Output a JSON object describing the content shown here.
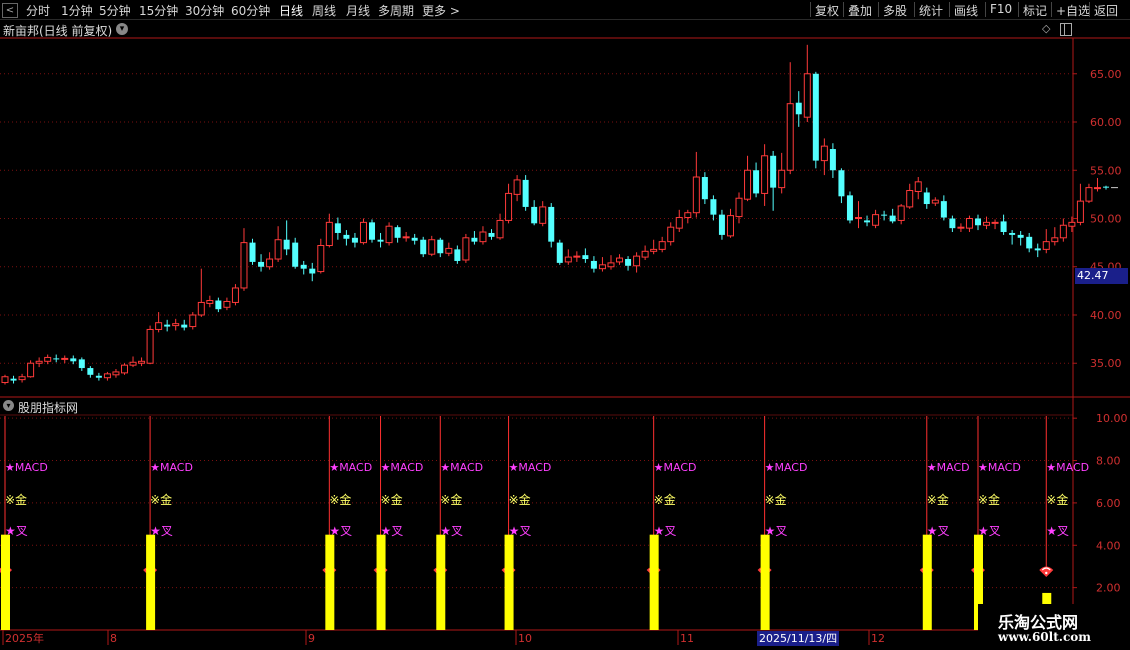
{
  "toolbar": {
    "back_arrow": "<",
    "period_tabs": [
      "分时",
      "1分钟",
      "5分钟",
      "15分钟",
      "30分钟",
      "60分钟",
      "日线",
      "周线",
      "月线",
      "多周期",
      "更多 >"
    ],
    "active_tab": "日线",
    "right_buttons": [
      "复权",
      "叠加",
      "多股",
      "统计",
      "画线",
      "F10",
      "标记",
      "+自选",
      "返回"
    ]
  },
  "stock": {
    "title": "新亩邦(日线 前复权)",
    "current_price": "42.47"
  },
  "indicator": {
    "title": "股朋指标网",
    "signal_labels": {
      "macd": "★MACD",
      "gold": "※金",
      "cross": "★叉"
    }
  },
  "watermark": {
    "title": "乐淘公式网",
    "url": "www.60lt.com"
  },
  "crosshair_date": "2025/11/13/四",
  "colors": {
    "up": "#ff3a3a",
    "down": "#54ffff",
    "grid": "#7a1010",
    "axis": "#b01818",
    "signal_bar": "#ffff00",
    "macd_text": "#ff40ff",
    "gold_text": "#ffff66"
  },
  "chart_data": {
    "type": "candlestick",
    "price_axis": {
      "ticks": [
        "65.00",
        "60.00",
        "55.00",
        "50.00",
        "45.00",
        "40.00",
        "35.00"
      ],
      "range": [
        31.5,
        68.5
      ]
    },
    "indicator_axis": {
      "ticks": [
        "10.00",
        "8.00",
        "6.00",
        "4.00",
        "2.00"
      ],
      "range": [
        0,
        11
      ]
    },
    "time_axis": [
      "2025年",
      "8",
      "9",
      "10",
      "11",
      "12"
    ],
    "candles": [
      [
        33.0,
        33.6,
        33.8,
        32.8
      ],
      [
        33.4,
        33.2,
        33.7,
        32.9
      ],
      [
        33.3,
        33.6,
        33.9,
        33.0
      ],
      [
        33.6,
        35.0,
        35.3,
        33.5
      ],
      [
        35.0,
        35.2,
        35.6,
        34.6
      ],
      [
        35.2,
        35.6,
        35.9,
        34.9
      ],
      [
        35.5,
        35.4,
        35.9,
        35.1
      ],
      [
        35.4,
        35.5,
        35.8,
        35.0
      ],
      [
        35.5,
        35.2,
        35.8,
        34.9
      ],
      [
        35.4,
        34.5,
        35.6,
        34.2
      ],
      [
        34.5,
        33.8,
        34.7,
        33.5
      ],
      [
        33.7,
        33.5,
        34.0,
        33.2
      ],
      [
        33.5,
        33.9,
        34.1,
        33.2
      ],
      [
        33.8,
        34.1,
        34.4,
        33.5
      ],
      [
        34.0,
        34.8,
        35.0,
        33.8
      ],
      [
        34.8,
        35.1,
        35.7,
        34.6
      ],
      [
        35.0,
        35.2,
        35.6,
        34.7
      ],
      [
        35.0,
        38.5,
        38.9,
        34.9
      ],
      [
        38.5,
        39.2,
        40.3,
        38.2
      ],
      [
        39.0,
        38.8,
        39.5,
        38.3
      ],
      [
        38.9,
        39.1,
        39.6,
        38.4
      ],
      [
        39.0,
        38.7,
        39.5,
        38.4
      ],
      [
        38.8,
        40.0,
        40.3,
        38.5
      ],
      [
        40.0,
        41.3,
        44.8,
        39.8
      ],
      [
        41.2,
        41.5,
        42.0,
        40.8
      ],
      [
        41.5,
        40.6,
        41.8,
        40.3
      ],
      [
        40.8,
        41.4,
        41.8,
        40.5
      ],
      [
        41.3,
        42.8,
        43.2,
        41.0
      ],
      [
        42.8,
        47.5,
        49.0,
        42.5
      ],
      [
        47.5,
        45.5,
        47.9,
        45.2
      ],
      [
        45.5,
        45.0,
        46.3,
        44.5
      ],
      [
        45.0,
        45.8,
        46.5,
        44.7
      ],
      [
        45.8,
        47.8,
        49.2,
        45.5
      ],
      [
        47.8,
        46.8,
        49.8,
        46.2
      ],
      [
        47.5,
        45.0,
        48.0,
        44.8
      ],
      [
        45.2,
        44.8,
        45.6,
        44.2
      ],
      [
        44.8,
        44.3,
        45.4,
        43.5
      ],
      [
        44.5,
        47.2,
        47.9,
        44.3
      ],
      [
        47.2,
        49.6,
        50.5,
        47.0
      ],
      [
        49.5,
        48.5,
        50.1,
        47.8
      ],
      [
        48.3,
        47.9,
        48.8,
        47.2
      ],
      [
        48.0,
        47.5,
        48.5,
        47.0
      ],
      [
        47.5,
        49.6,
        50.0,
        47.3
      ],
      [
        49.6,
        47.8,
        49.9,
        47.5
      ],
      [
        47.8,
        47.6,
        48.5,
        47.0
      ],
      [
        47.5,
        49.2,
        49.6,
        47.2
      ],
      [
        49.1,
        48.0,
        49.3,
        47.5
      ],
      [
        48.0,
        48.1,
        48.6,
        47.6
      ],
      [
        48.0,
        47.7,
        48.4,
        47.3
      ],
      [
        47.8,
        46.3,
        48.1,
        46.0
      ],
      [
        46.3,
        47.8,
        48.2,
        46.1
      ],
      [
        47.8,
        46.4,
        48.0,
        46.0
      ],
      [
        46.4,
        46.9,
        47.5,
        46.1
      ],
      [
        46.8,
        45.6,
        47.2,
        45.3
      ],
      [
        45.7,
        48.0,
        48.4,
        45.4
      ],
      [
        48.0,
        47.6,
        48.7,
        47.3
      ],
      [
        47.6,
        48.6,
        49.2,
        47.3
      ],
      [
        48.5,
        48.1,
        48.9,
        47.8
      ],
      [
        48.0,
        49.8,
        50.5,
        47.8
      ],
      [
        49.8,
        52.6,
        53.6,
        49.5
      ],
      [
        52.5,
        54.0,
        54.5,
        51.8
      ],
      [
        54.0,
        51.2,
        54.5,
        50.8
      ],
      [
        51.2,
        49.5,
        51.9,
        49.3
      ],
      [
        49.5,
        51.2,
        51.8,
        49.2
      ],
      [
        51.2,
        47.6,
        51.6,
        47.0
      ],
      [
        47.5,
        45.4,
        47.8,
        45.2
      ],
      [
        45.5,
        46.0,
        46.8,
        45.2
      ],
      [
        46.0,
        46.1,
        46.6,
        45.5
      ],
      [
        46.2,
        45.8,
        46.9,
        45.4
      ],
      [
        45.6,
        44.8,
        46.1,
        44.4
      ],
      [
        44.8,
        45.2,
        46.0,
        44.5
      ],
      [
        45.0,
        45.4,
        46.2,
        44.7
      ],
      [
        45.5,
        45.9,
        46.3,
        45.2
      ],
      [
        45.8,
        45.1,
        46.1,
        44.6
      ],
      [
        45.1,
        46.1,
        46.5,
        44.4
      ],
      [
        46.0,
        46.6,
        47.2,
        45.7
      ],
      [
        46.6,
        46.8,
        47.8,
        46.3
      ],
      [
        46.8,
        47.6,
        48.1,
        46.5
      ],
      [
        47.6,
        49.1,
        49.6,
        47.2
      ],
      [
        49.0,
        50.1,
        50.9,
        48.6
      ],
      [
        50.1,
        50.6,
        50.9,
        49.5
      ],
      [
        50.6,
        54.3,
        56.9,
        50.1
      ],
      [
        54.3,
        52.0,
        54.8,
        51.5
      ],
      [
        52.0,
        50.4,
        52.4,
        49.8
      ],
      [
        50.4,
        48.3,
        50.9,
        47.8
      ],
      [
        48.2,
        50.3,
        51.0,
        48.0
      ],
      [
        50.2,
        52.1,
        52.7,
        49.5
      ],
      [
        52.0,
        55.0,
        56.5,
        51.8
      ],
      [
        55.0,
        52.6,
        55.8,
        52.2
      ],
      [
        52.6,
        56.5,
        57.7,
        51.3
      ],
      [
        56.5,
        53.2,
        57.0,
        50.8
      ],
      [
        53.2,
        55.0,
        56.8,
        52.6
      ],
      [
        55.0,
        61.9,
        66.2,
        54.6
      ],
      [
        62.0,
        60.8,
        63.2,
        59.5
      ],
      [
        60.5,
        65.0,
        68.0,
        60.0
      ],
      [
        65.0,
        56.0,
        65.2,
        55.2
      ],
      [
        56.0,
        57.5,
        58.3,
        54.5
      ],
      [
        57.2,
        55.0,
        57.8,
        54.2
      ],
      [
        55.0,
        52.3,
        55.2,
        51.6
      ],
      [
        52.4,
        49.8,
        52.8,
        49.5
      ],
      [
        50.0,
        50.1,
        51.8,
        49.0
      ],
      [
        49.8,
        49.6,
        50.3,
        49.2
      ],
      [
        49.3,
        50.4,
        50.9,
        49.0
      ],
      [
        50.4,
        50.3,
        50.8,
        49.8
      ],
      [
        50.3,
        49.7,
        51.0,
        49.5
      ],
      [
        49.8,
        51.3,
        51.5,
        49.4
      ],
      [
        51.2,
        52.9,
        53.6,
        51.0
      ],
      [
        52.8,
        53.8,
        54.3,
        52.0
      ],
      [
        52.7,
        51.5,
        53.2,
        51.0
      ],
      [
        51.6,
        51.9,
        52.2,
        51.3
      ],
      [
        51.8,
        50.1,
        52.4,
        49.8
      ],
      [
        50.0,
        49.0,
        50.3,
        48.6
      ],
      [
        49.0,
        49.1,
        49.5,
        48.6
      ],
      [
        49.0,
        50.0,
        50.3,
        48.6
      ],
      [
        50.0,
        49.3,
        50.4,
        48.8
      ],
      [
        49.3,
        49.6,
        50.2,
        48.9
      ],
      [
        49.6,
        49.6,
        49.9,
        48.9
      ],
      [
        49.7,
        48.6,
        50.4,
        48.3
      ],
      [
        48.5,
        48.3,
        48.8,
        47.3
      ],
      [
        48.3,
        48.0,
        48.7,
        47.2
      ],
      [
        48.1,
        46.9,
        48.5,
        46.5
      ],
      [
        46.9,
        46.7,
        47.4,
        46.0
      ],
      [
        46.8,
        47.6,
        48.9,
        46.4
      ],
      [
        47.6,
        48.0,
        49.1,
        47.2
      ],
      [
        48.0,
        49.3,
        50.0,
        47.6
      ],
      [
        49.2,
        49.6,
        50.2,
        48.6
      ],
      [
        49.6,
        51.8,
        53.6,
        49.3
      ],
      [
        51.8,
        53.2,
        53.6,
        51.6
      ],
      [
        53.2,
        53.2,
        54.2,
        52.8
      ],
      [
        53.3,
        53.2,
        53.4,
        53.0
      ]
    ],
    "signals": [
      {
        "candle": 0,
        "value": 4.5
      },
      {
        "candle": 17,
        "value": 4.5
      },
      {
        "candle": 38,
        "value": 4.5
      },
      {
        "candle": 44,
        "value": 4.5
      },
      {
        "candle": 51,
        "value": 4.5
      },
      {
        "candle": 59,
        "value": 4.5
      },
      {
        "candle": 76,
        "value": 4.5
      },
      {
        "candle": 89,
        "value": 4.5
      },
      {
        "candle": 108,
        "value": 4.5
      },
      {
        "candle": 114,
        "value": 4.5
      },
      {
        "candle": 122,
        "value": 1.75
      }
    ]
  }
}
